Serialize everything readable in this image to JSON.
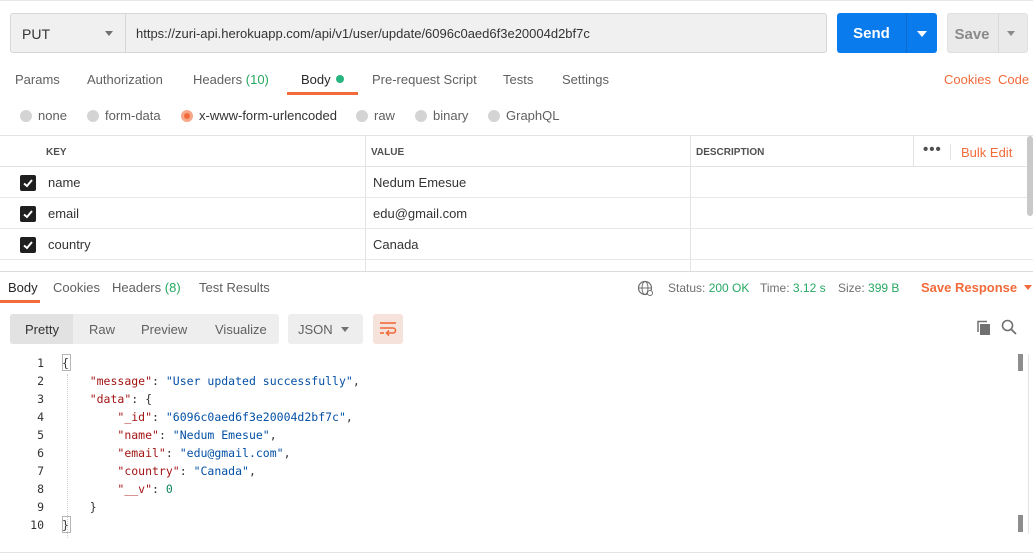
{
  "request": {
    "method": "PUT",
    "url": "https://zuri-api.herokuapp.com/api/v1/user/update/6096c0aed6f3e20004d2bf7c",
    "send_label": "Send",
    "save_label": "Save"
  },
  "request_tabs": {
    "params": "Params",
    "authorization": "Authorization",
    "headers": "Headers",
    "headers_count": "(10)",
    "body": "Body",
    "prerequest": "Pre-request Script",
    "tests": "Tests",
    "settings": "Settings",
    "cookies": "Cookies",
    "code": "Code"
  },
  "body_types": {
    "none": "none",
    "form_data": "form-data",
    "urlencoded": "x-www-form-urlencoded",
    "raw": "raw",
    "binary": "binary",
    "graphql": "GraphQL",
    "selected": "x-www-form-urlencoded"
  },
  "params_table": {
    "columns": {
      "key": "KEY",
      "value": "VALUE",
      "description": "DESCRIPTION"
    },
    "bulk_edit": "Bulk Edit",
    "rows": [
      {
        "key": "name",
        "value": "Nedum Emesue",
        "checked": true
      },
      {
        "key": "email",
        "value": "edu@gmail.com",
        "checked": true
      },
      {
        "key": "country",
        "value": "Canada",
        "checked": true
      }
    ]
  },
  "response_tabs": {
    "body": "Body",
    "cookies": "Cookies",
    "headers": "Headers",
    "headers_count": "(8)",
    "test_results": "Test Results"
  },
  "response_meta": {
    "status_label": "Status:",
    "status_value": "200 OK",
    "time_label": "Time:",
    "time_value": "3.12 s",
    "size_label": "Size:",
    "size_value": "399 B",
    "save_response": "Save Response"
  },
  "view_modes": {
    "pretty": "Pretty",
    "raw": "Raw",
    "preview": "Preview",
    "visualize": "Visualize",
    "format": "JSON"
  },
  "response_body": {
    "line_numbers": [
      "1",
      "2",
      "3",
      "4",
      "5",
      "6",
      "7",
      "8",
      "9",
      "10"
    ],
    "message_key": "\"message\"",
    "message_value": "\"User updated successfully\"",
    "data_key": "\"data\"",
    "id_key": "\"_id\"",
    "id_value": "\"6096c0aed6f3e20004d2bf7c\"",
    "name_key": "\"name\"",
    "name_value": "\"Nedum Emesue\"",
    "email_key": "\"email\"",
    "email_value": "\"edu@gmail.com\"",
    "country_key": "\"country\"",
    "country_value": "\"Canada\"",
    "v_key": "\"__v\"",
    "v_value": "0"
  },
  "colors": {
    "accent": "#f26b3a",
    "send_button": "#097bed",
    "success": "#26a862"
  }
}
